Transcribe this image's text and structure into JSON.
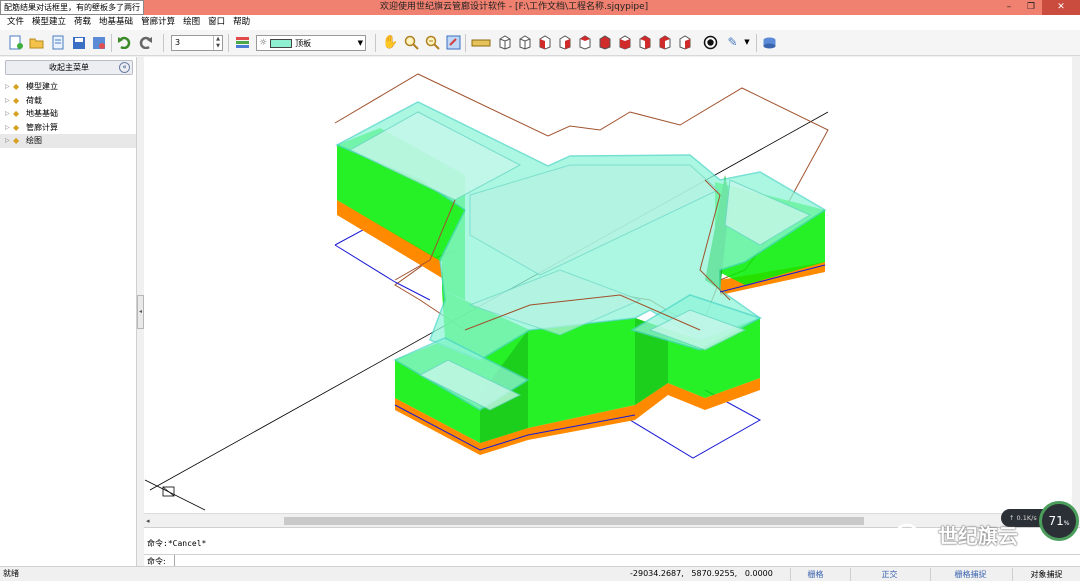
{
  "titlebar": {
    "tooltip": "配筋结果对话框里，有的壁板多了两行",
    "title": "欢迎使用世纪旗云管廊设计软件          - [F:\\工作文档\\工程名称.sjqypipe]",
    "minimize": "–",
    "restore": "❐",
    "close": "✕"
  },
  "menu": [
    "文件",
    "模型建立",
    "荷载",
    "地基基础",
    "管廊计算",
    "绘图",
    "窗口",
    "帮助"
  ],
  "toolbar": {
    "number_value": "3",
    "layer_name": "顶板",
    "layer_color": "#8ef0d0"
  },
  "sidebar": {
    "header": "收起主菜单",
    "collapse_glyph": "«",
    "items": [
      {
        "label": "模型建立"
      },
      {
        "label": "荷载"
      },
      {
        "label": "地基基础"
      },
      {
        "label": "管廊计算"
      },
      {
        "label": "绘图"
      }
    ]
  },
  "command": {
    "history": "命令:*Cancel*",
    "prompt_label": "命令:",
    "input_value": ""
  },
  "status": {
    "ready": "就绪",
    "coords": "-29034.2687,   5870.9255,   0.0000",
    "grid": "栅格",
    "ortho": "正交",
    "grid_snap": "栅格捕捉",
    "object_snap": "对象捕捉"
  },
  "overlay": {
    "network_speed": "0.1K/s",
    "cpu_percent": "71",
    "cpu_unit": "%",
    "watermark": "世纪旗云"
  },
  "colors": {
    "titlebar": "#f0806f",
    "wall_fill": "#00ee00",
    "slab_fill": "#8ff5d8",
    "base_fill": "#ff8a00",
    "outline_brown": "#a0522d",
    "outline_blue": "#1a1ad6"
  }
}
